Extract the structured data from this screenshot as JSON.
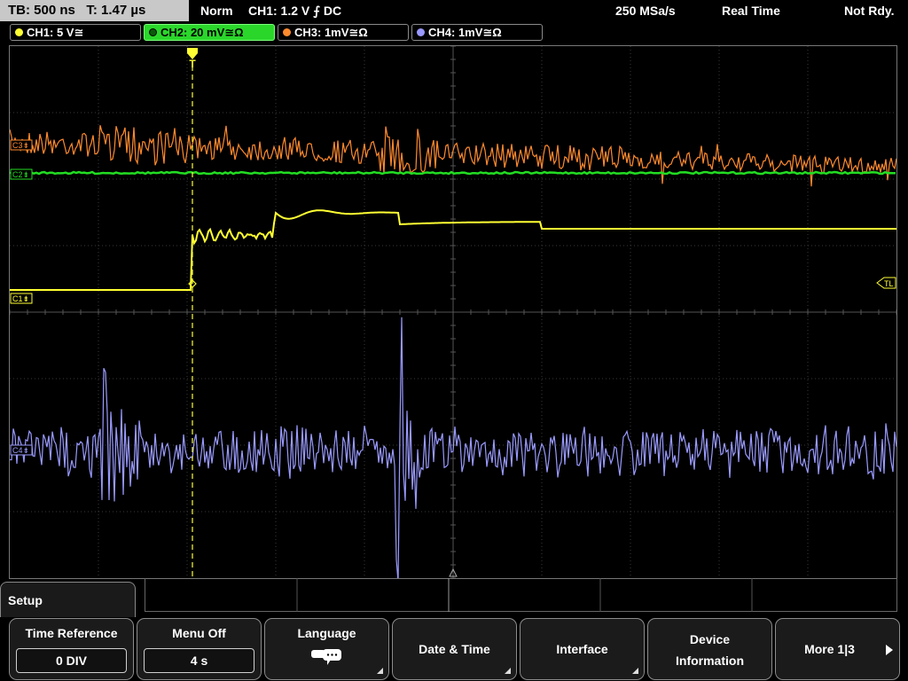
{
  "status": {
    "timebase": "TB: 500 ns",
    "trigger_time": "T: 1.47 µs",
    "mode": "Norm",
    "trigger": "CH1: 1.2 V ⨍ DC",
    "sample_rate": "250 MSa/s",
    "acq_mode": "Real Time",
    "state": "Not Rdy."
  },
  "channels": [
    {
      "label": "CH1: 5 V≅",
      "color": "#ffff33"
    },
    {
      "label": "CH2: 20 mV≅Ω",
      "color": "#2bd62b"
    },
    {
      "label": "CH3: 1mV≅Ω",
      "color": "#ff8a2e"
    },
    {
      "label": "CH4: 1mV≅Ω",
      "color": "#9999ff"
    }
  ],
  "markers": {
    "ch1": "C1⇟",
    "ch2": "C2⇟",
    "ch3": "C3⇟",
    "ch4": "C4⇟",
    "trigger_level": "TL",
    "trigger_pos": "T"
  },
  "menu": {
    "title": "Setup",
    "soft_keys": [
      {
        "label": "Time Reference",
        "value": "0 DIV"
      },
      {
        "label": "Menu Off",
        "value": "4 s"
      },
      {
        "label": "Language"
      },
      {
        "label": "Date & Time"
      },
      {
        "label": "Interface"
      },
      {
        "line1": "Device",
        "line2": "Information"
      },
      {
        "label": "More 1|3"
      }
    ]
  },
  "icons": {
    "language": "speech-bubbles-icon",
    "more": "arrow-right-icon",
    "submenu": "corner-triangle-icon"
  }
}
